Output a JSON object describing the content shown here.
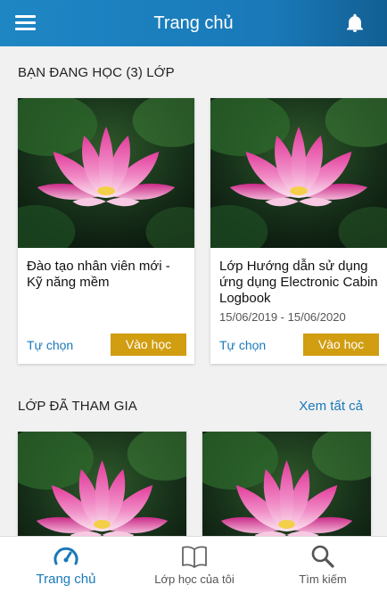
{
  "header": {
    "title": "Trang chủ",
    "menu_icon": "menu-icon",
    "notification_icon": "bell-icon"
  },
  "enrolled": {
    "title": "BẠN ĐANG HỌC (3) LỚP",
    "cards": [
      {
        "name": "Đào tạo nhân viên mới - Kỹ năng mềm",
        "dates": "",
        "option_label": "Tự chọn",
        "enter_label": "Vào học"
      },
      {
        "name": "Lớp Hướng dẫn sử dụng ứng dụng Electronic Cabin Logbook",
        "dates": "15/06/2019 - 15/06/2020",
        "option_label": "Tự chọn",
        "enter_label": "Vào học"
      }
    ]
  },
  "joined": {
    "title": "LỚP ĐÃ THAM GIA",
    "see_all": "Xem tất cả"
  },
  "bottom_nav": {
    "items": [
      {
        "label": "Trang chủ",
        "icon": "speedometer-icon",
        "active": true
      },
      {
        "label": "Lớp học của tôi",
        "icon": "book-icon",
        "active": false
      },
      {
        "label": "Tìm kiếm",
        "icon": "search-icon",
        "active": false
      }
    ]
  },
  "colors": {
    "primary": "#1a79b8",
    "accent": "#d19d11"
  }
}
